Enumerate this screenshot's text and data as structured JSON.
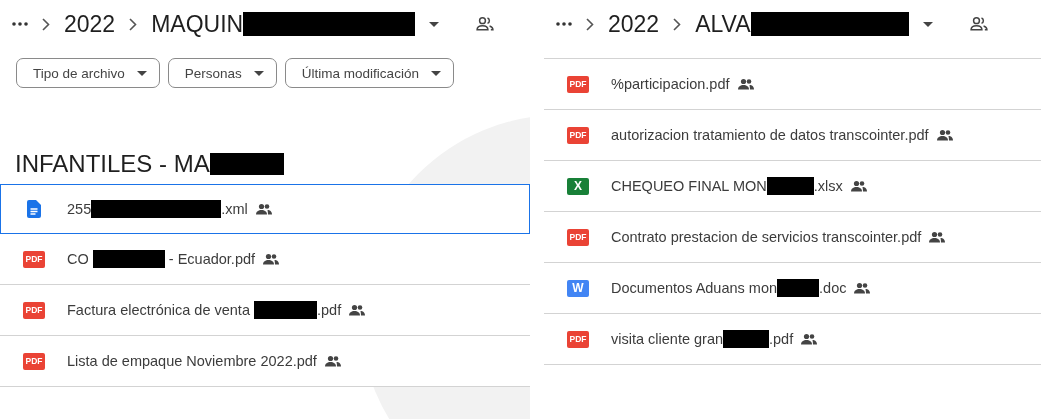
{
  "left_panel": {
    "breadcrumb": {
      "parent": "2022",
      "folder": {
        "prefix": "MAQUIN",
        "redacted": true
      }
    },
    "filters": [
      {
        "label": "Tipo de archivo"
      },
      {
        "label": "Personas"
      },
      {
        "label": "Última modificación"
      }
    ],
    "section_title": {
      "prefix": "INFANTILES - MA",
      "redacted": true
    },
    "files": [
      {
        "kind": "doc",
        "prefix": "255",
        "redacted": true,
        "suffix": ".xml",
        "selected": true,
        "shared": true
      },
      {
        "kind": "pdf",
        "badge": "PDF",
        "prefix": "CO ",
        "redacted": true,
        "suffix": " - Ecuador.pdf",
        "selected": false,
        "shared": true
      },
      {
        "kind": "pdf",
        "badge": "PDF",
        "prefix": "Factura electrónica de venta ",
        "redacted": true,
        "suffix": ".pdf",
        "selected": false,
        "shared": true
      },
      {
        "kind": "pdf",
        "badge": "PDF",
        "prefix": "Lista de empaque Noviembre 2022.pdf",
        "redacted": false,
        "selected": false,
        "shared": true
      }
    ]
  },
  "right_panel": {
    "breadcrumb": {
      "parent": "2022",
      "folder": {
        "prefix": "ALVA",
        "redacted": true
      }
    },
    "files": [
      {
        "kind": "pdf",
        "badge": "PDF",
        "prefix": "%participacion.pdf",
        "redacted": false,
        "selected": false,
        "shared": true
      },
      {
        "kind": "pdf",
        "badge": "PDF",
        "prefix": "autorizacion tratamiento de datos transcointer.pdf",
        "redacted": false,
        "selected": false,
        "shared": true
      },
      {
        "kind": "sheet",
        "badge": "X",
        "prefix": "CHEQUEO FINAL MON",
        "redacted": true,
        "suffix": ".xlsx",
        "selected": false,
        "shared": true
      },
      {
        "kind": "pdf",
        "badge": "PDF",
        "prefix": "Contrato prestacion de servicios transcointer.pdf",
        "redacted": false,
        "selected": false,
        "shared": true
      },
      {
        "kind": "word",
        "badge": "W",
        "prefix": "Documentos Aduans mon",
        "redacted": true,
        "suffix": ".doc",
        "selected": false,
        "shared": true
      },
      {
        "kind": "pdf",
        "badge": "PDF",
        "prefix": "visita cliente gran",
        "redacted": true,
        "suffix": ".pdf",
        "selected": false,
        "shared": true
      }
    ]
  }
}
